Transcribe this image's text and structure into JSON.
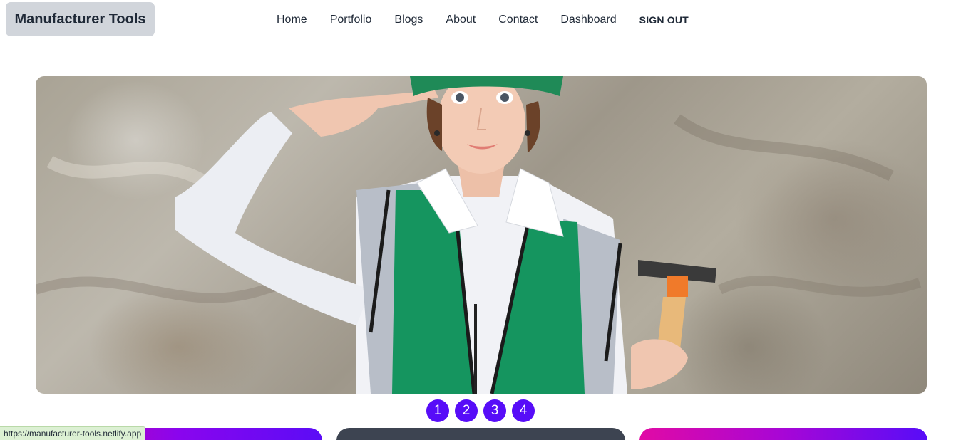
{
  "header": {
    "brand": "Manufacturer Tools",
    "nav": [
      {
        "label": "Home"
      },
      {
        "label": "Portfolio"
      },
      {
        "label": "Blogs"
      },
      {
        "label": "About"
      },
      {
        "label": "Contact"
      },
      {
        "label": "Dashboard"
      },
      {
        "label": "SIGN OUT"
      }
    ]
  },
  "hero": {
    "image": "woman-worker-with-hammer-photo",
    "slides": [
      "1",
      "2",
      "3",
      "4"
    ]
  },
  "cards": {
    "colors": [
      "#8a05ee",
      "#3d4451",
      "#a706d6"
    ]
  },
  "status_bar": {
    "url": "https://manufacturer-tools.netlify.app"
  },
  "colors": {
    "primary": "#570df8",
    "brand_bg": "#d1d5db",
    "neutral": "#3d4451"
  }
}
